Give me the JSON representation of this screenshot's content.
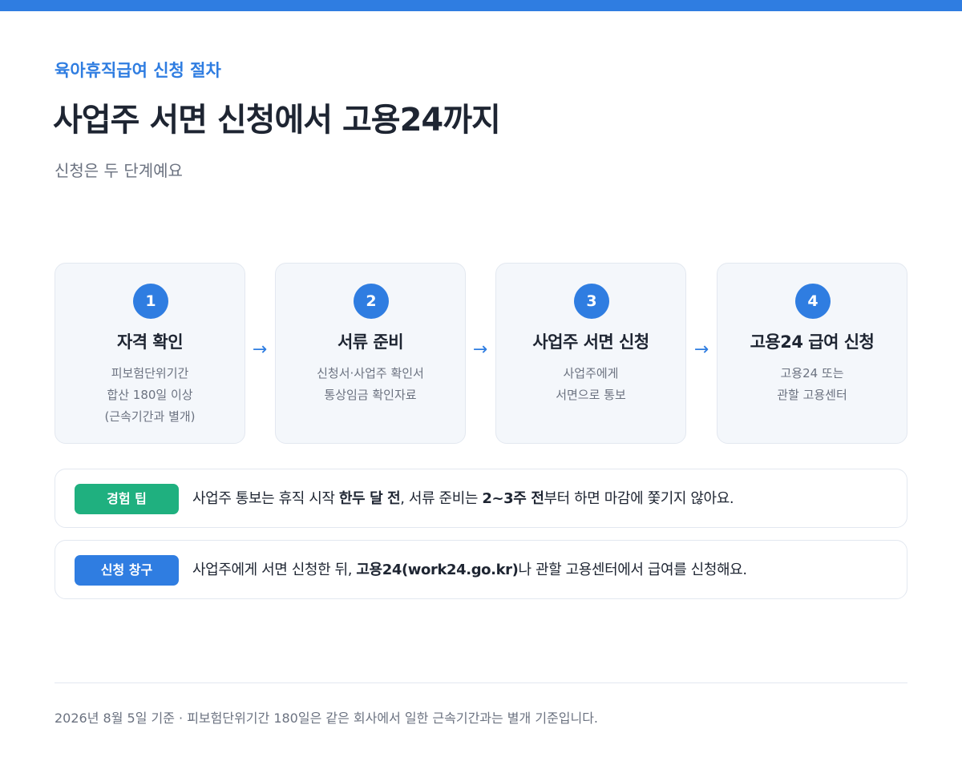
{
  "colors": {
    "accent": "#2f7de1",
    "tip_badge": "#1fb07f",
    "channel_badge": "#2f7de1"
  },
  "header": {
    "eyebrow": "육아휴직급여 신청 절차",
    "title": "사업주 서면 신청에서 고용24까지",
    "subtitle": "신청은 두 단계예요"
  },
  "steps": [
    {
      "number": "1",
      "title": "자격 확인",
      "lines": [
        "피보험단위기간",
        "합산 180일 이상",
        "(근속기간과 별개)"
      ]
    },
    {
      "number": "2",
      "title": "서류 준비",
      "lines": [
        "신청서·사업주 확인서",
        "통상임금 확인자료"
      ]
    },
    {
      "number": "3",
      "title": "사업주 서면 신청",
      "lines": [
        "사업주에게",
        "서면으로 통보"
      ]
    },
    {
      "number": "4",
      "title": "고용24 급여 신청",
      "lines": [
        "고용24 또는",
        "관할 고용센터"
      ]
    }
  ],
  "arrow_icon": "→",
  "notes": {
    "tip": {
      "badge": "경험 팁",
      "segments": [
        "사업주 통보는 휴직 시작 ",
        "한두 달 전",
        ", 서류 준비는 ",
        "2~3주 전",
        "부터 하면 마감에 쫓기지 않아요."
      ]
    },
    "channel": {
      "badge": "신청 창구",
      "segments": [
        "사업주에게 서면 신청한 뒤, ",
        "고용24(work24.go.kr)",
        "나 관할 고용센터에서 급여를 신청해요."
      ]
    }
  },
  "footer": "2026년 8월 5일 기준 · 피보험단위기간 180일은 같은 회사에서 일한 근속기간과는 별개 기준입니다."
}
